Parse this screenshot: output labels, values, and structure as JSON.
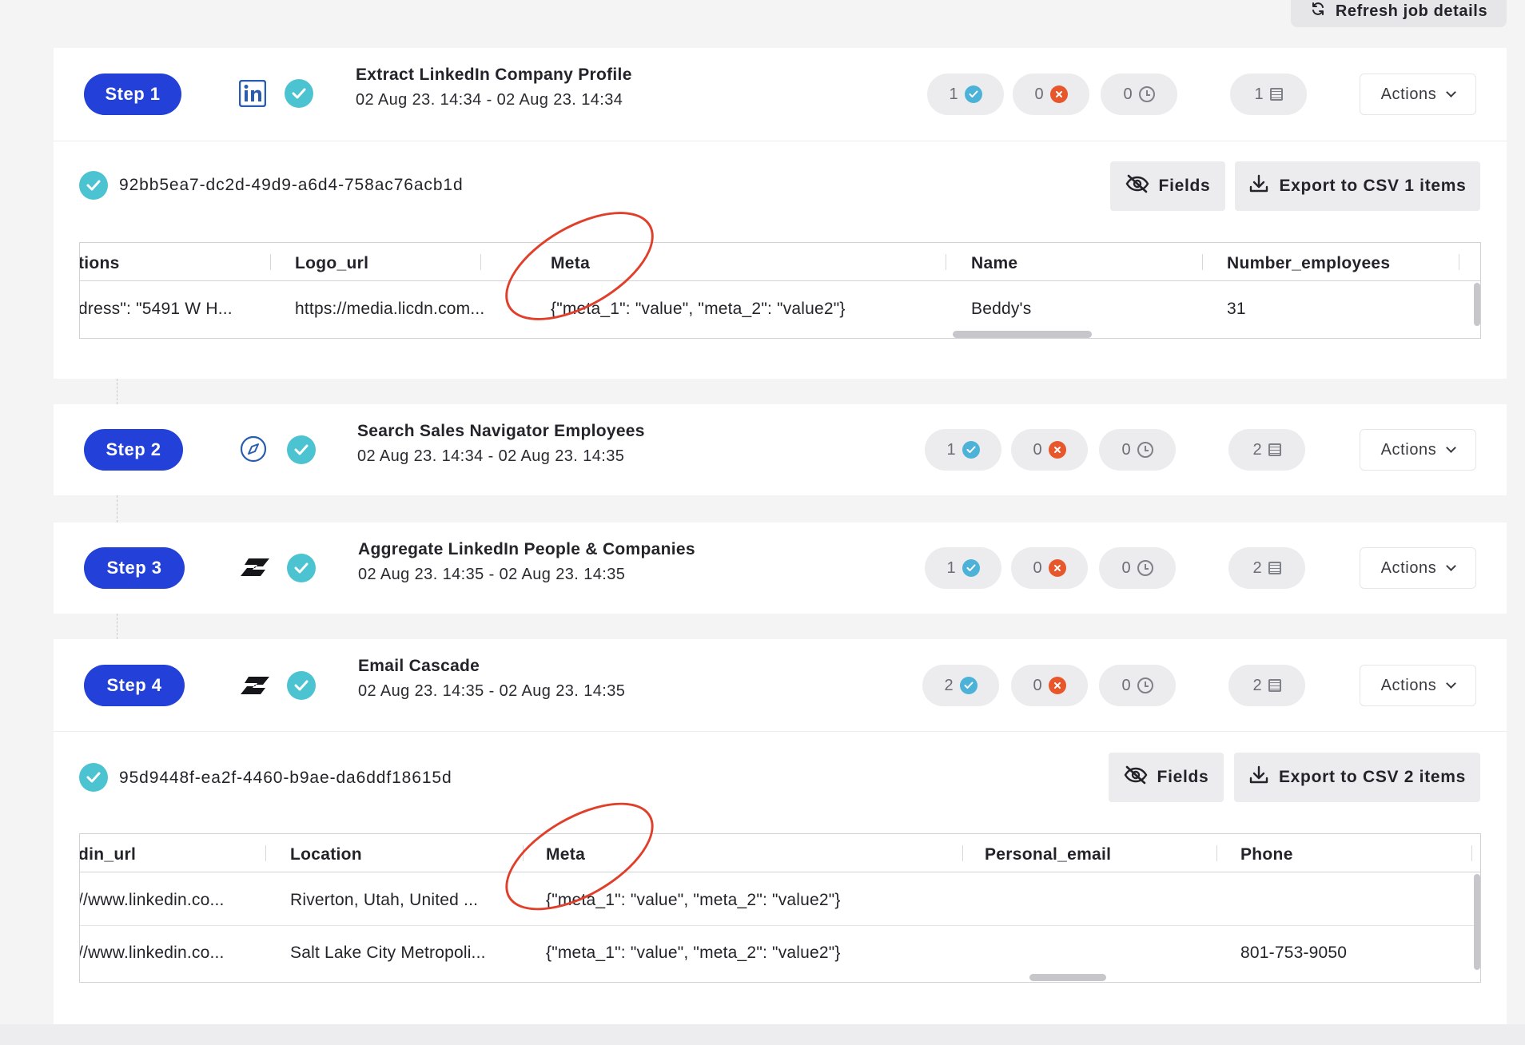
{
  "header": {
    "refresh_label": "Refresh job details"
  },
  "steps": [
    {
      "label": "Step 1",
      "icon": "linkedin-icon",
      "title": "Extract LinkedIn Company Profile",
      "dates": "02 Aug 23. 14:34 - 02 Aug 23. 14:34",
      "success": "1",
      "failed": "0",
      "pending": "0",
      "records": "1",
      "actions_label": "Actions"
    },
    {
      "label": "Step 2",
      "icon": "compass-icon",
      "title": "Search Sales Navigator Employees",
      "dates": "02 Aug 23. 14:34 - 02 Aug 23. 14:35",
      "success": "1",
      "failed": "0",
      "pending": "0",
      "records": "2",
      "actions_label": "Actions"
    },
    {
      "label": "Step 3",
      "icon": "app-logo-icon",
      "title": "Aggregate LinkedIn People & Companies",
      "dates": "02 Aug 23. 14:35 - 02 Aug 23. 14:35",
      "success": "1",
      "failed": "0",
      "pending": "0",
      "records": "2",
      "actions_label": "Actions"
    },
    {
      "label": "Step 4",
      "icon": "app-logo-icon",
      "title": "Email Cascade",
      "dates": "02 Aug 23. 14:35 - 02 Aug 23. 14:35",
      "success": "2",
      "failed": "0",
      "pending": "0",
      "records": "2",
      "actions_label": "Actions"
    }
  ],
  "results": [
    {
      "id": "92bb5ea7-dc2d-49d9-a6d4-758ac76acb1d",
      "fields_label": "Fields",
      "export_label": "Export to CSV 1 items",
      "columns": [
        "tions",
        "Logo_url",
        "Meta",
        "Name",
        "Number_employees"
      ],
      "rows": [
        [
          "dress\": \"5491 W H...",
          "https://media.licdn.com...",
          "{\"meta_1\": \"value\", \"meta_2\": \"value2\"}",
          "Beddy's",
          "31"
        ]
      ]
    },
    {
      "id": "95d9448f-ea2f-4460-b9ae-da6ddf18615d",
      "fields_label": "Fields",
      "export_label": "Export to CSV 2 items",
      "columns": [
        "din_url",
        "Location",
        "Meta",
        "Personal_email",
        "Phone"
      ],
      "rows": [
        [
          "//www.linkedin.co...",
          "Riverton, Utah, United ...",
          "{\"meta_1\": \"value\", \"meta_2\": \"value2\"}",
          "",
          ""
        ],
        [
          "//www.linkedin.co...",
          "Salt Lake City Metropoli...",
          "{\"meta_1\": \"value\", \"meta_2\": \"value2\"}",
          "",
          "801-753-9050"
        ]
      ]
    }
  ],
  "colors": {
    "step_pill": "#2340d8",
    "check": "#4cc3d1",
    "failed": "#e8572b",
    "annotation": "#e0402b"
  }
}
